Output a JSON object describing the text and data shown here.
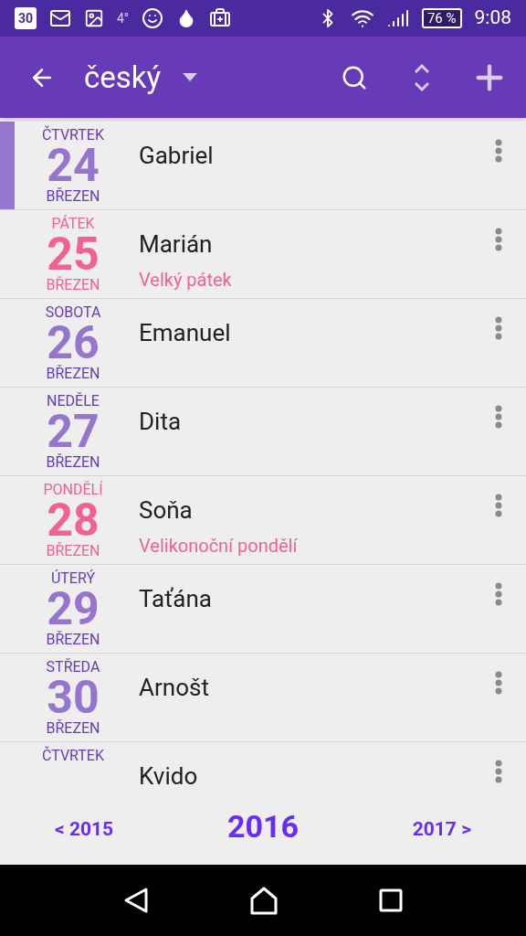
{
  "status_bar": {
    "calendar_day": "30",
    "temperature": "4°",
    "battery": "76 %",
    "time": "9:08"
  },
  "toolbar": {
    "title": "český"
  },
  "rows": [
    {
      "weekday": "ČTVRTEK",
      "day": "24",
      "month": "BŘEZEN",
      "name": "Gabriel",
      "holiday": false,
      "selected": true
    },
    {
      "weekday": "PÁTEK",
      "day": "25",
      "month": "BŘEZEN",
      "name": "Marián",
      "note": "Velký pátek",
      "holiday": true,
      "selected": false
    },
    {
      "weekday": "SOBOTA",
      "day": "26",
      "month": "BŘEZEN",
      "name": "Emanuel",
      "holiday": false,
      "selected": false
    },
    {
      "weekday": "NEDĚLE",
      "day": "27",
      "month": "BŘEZEN",
      "name": "Dita",
      "holiday": false,
      "selected": false
    },
    {
      "weekday": "PONDĚLÍ",
      "day": "28",
      "month": "BŘEZEN",
      "name": "Soňa",
      "note": "Velikonoční pondělí",
      "holiday": true,
      "selected": false
    },
    {
      "weekday": "ÚTERÝ",
      "day": "29",
      "month": "BŘEZEN",
      "name": "Taťána",
      "holiday": false,
      "selected": false
    },
    {
      "weekday": "STŘEDA",
      "day": "30",
      "month": "BŘEZEN",
      "name": "Arnošt",
      "holiday": false,
      "selected": false
    },
    {
      "weekday": "ČTVRTEK",
      "name": "Kvido",
      "holiday": false,
      "selected": false
    }
  ],
  "year_nav": {
    "previous": "< 2015",
    "current": "2016",
    "next": "2017 >"
  }
}
